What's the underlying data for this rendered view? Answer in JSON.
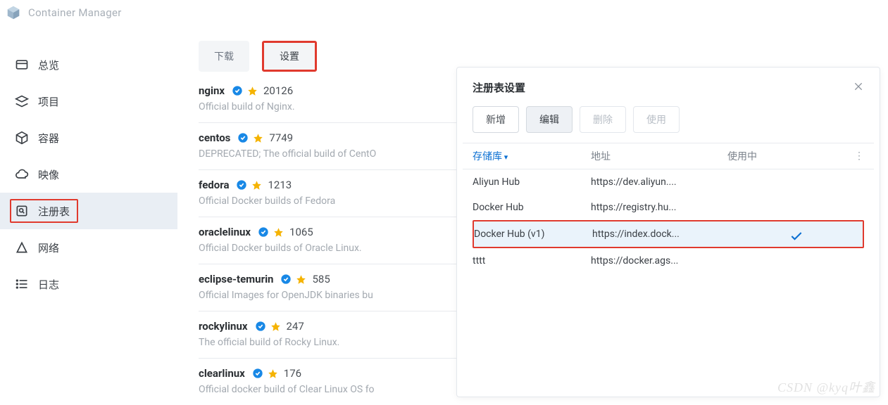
{
  "header": {
    "app_title": "Container Manager"
  },
  "sidebar": {
    "items": [
      {
        "label": "总览"
      },
      {
        "label": "项目"
      },
      {
        "label": "容器"
      },
      {
        "label": "映像"
      },
      {
        "label": "注册表"
      },
      {
        "label": "网络"
      },
      {
        "label": "日志"
      }
    ],
    "active_index": 4
  },
  "tabs": {
    "download": "下载",
    "settings": "设置"
  },
  "repos": [
    {
      "name": "nginx",
      "stars": "20126",
      "desc": "Official build of Nginx."
    },
    {
      "name": "centos",
      "stars": "7749",
      "desc": "DEPRECATED; The official build of CentO"
    },
    {
      "name": "fedora",
      "stars": "1213",
      "desc": "Official Docker builds of Fedora"
    },
    {
      "name": "oraclelinux",
      "stars": "1065",
      "desc": "Official Docker builds of Oracle Linux."
    },
    {
      "name": "eclipse-temurin",
      "stars": "585",
      "desc": "Official Images for OpenJDK binaries bu"
    },
    {
      "name": "rockylinux",
      "stars": "247",
      "desc": "The official build of Rocky Linux."
    },
    {
      "name": "clearlinux",
      "stars": "176",
      "desc": "Official docker build of Clear Linux OS fo"
    }
  ],
  "modal": {
    "title": "注册表设置",
    "buttons": {
      "add": "新增",
      "edit": "编辑",
      "delete": "删除",
      "use": "使用"
    },
    "columns": {
      "repo": "存储库",
      "address": "地址",
      "inuse": "使用中"
    },
    "rows": [
      {
        "repo": "Aliyun Hub",
        "address": "https://dev.aliyun....",
        "inuse": false
      },
      {
        "repo": "Docker Hub",
        "address": "https://registry.hu...",
        "inuse": false
      },
      {
        "repo": "Docker Hub (v1)",
        "address": "https://index.dock...",
        "inuse": true
      },
      {
        "repo": "tttt",
        "address": "https://docker.ags...",
        "inuse": false
      }
    ],
    "selected_index": 2
  },
  "watermark": "CSDN @kyq叶鑫"
}
